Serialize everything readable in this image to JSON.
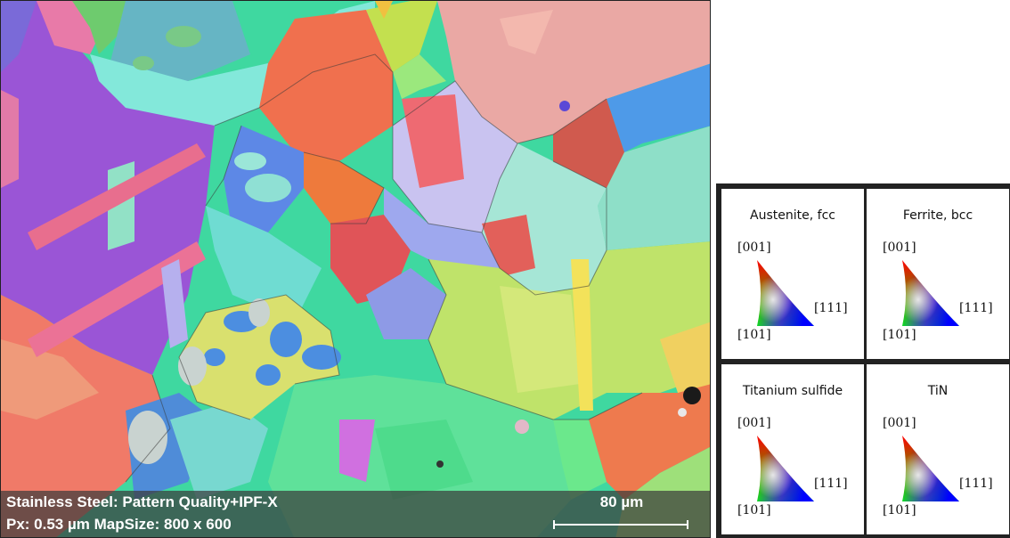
{
  "map": {
    "caption_line1": "Stainless Steel: Pattern Quality+IPF-X",
    "caption_line2": "Px: 0.53 µm  MapSize: 800 x 600",
    "scale_bar_label": "80 µm"
  },
  "legend": {
    "cells": [
      {
        "phase": "Austenite, fcc",
        "pole_top": "[001]",
        "pole_right": "[111]",
        "pole_bottom": "[101]"
      },
      {
        "phase": "Ferrite, bcc",
        "pole_top": "[001]",
        "pole_right": "[111]",
        "pole_bottom": "[101]"
      },
      {
        "phase": "Titanium sulfide",
        "pole_top": "[001]",
        "pole_right": "[111]",
        "pole_bottom": "[101]"
      },
      {
        "phase": "TiN",
        "pole_top": "[001]",
        "pole_right": "[111]",
        "pole_bottom": "[101]"
      }
    ]
  },
  "colors": {
    "ipf_001": "#ff0000",
    "ipf_101": "#00ff00",
    "ipf_111": "#0000ff"
  }
}
